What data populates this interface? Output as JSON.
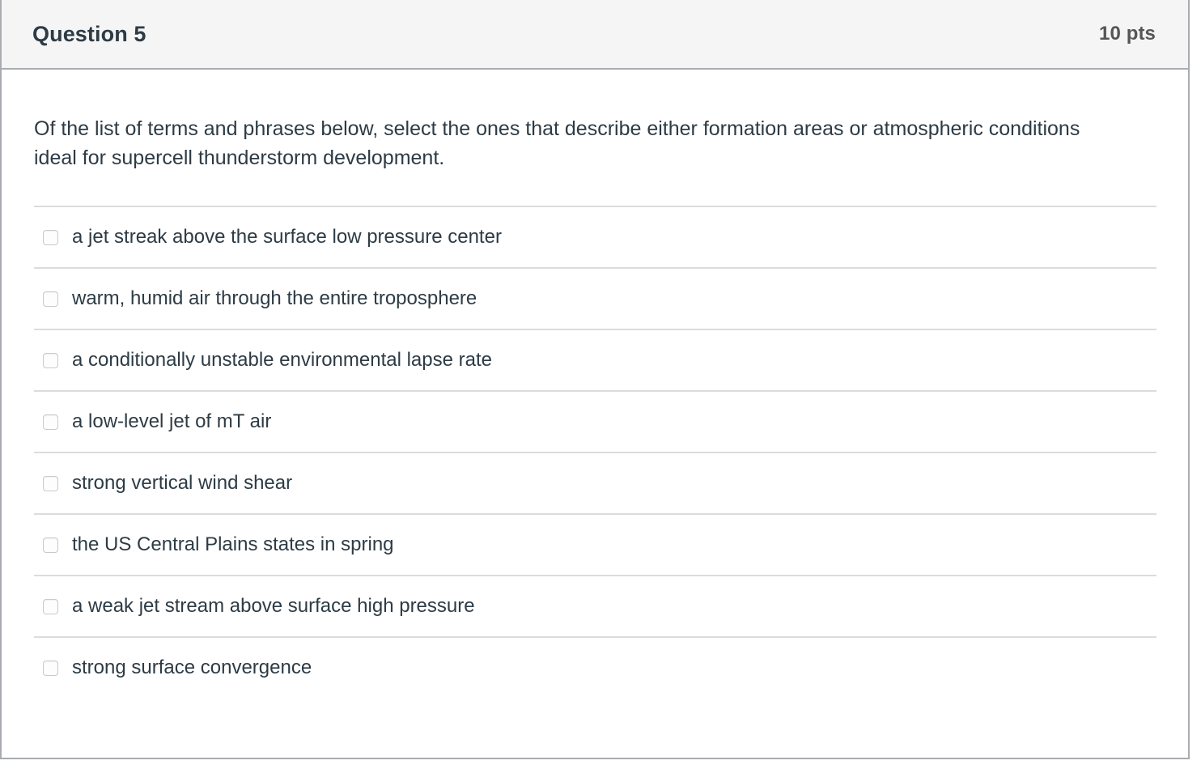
{
  "header": {
    "title": "Question 5",
    "points": "10 pts"
  },
  "question": {
    "prompt": "Of the list of terms and phrases below, select the ones that describe either formation areas or atmospheric conditions ideal for supercell thunderstorm development."
  },
  "answers": [
    {
      "label": "a jet streak above the surface low pressure center",
      "checked": false
    },
    {
      "label": "warm, humid air through the entire troposphere",
      "checked": false
    },
    {
      "label": "a conditionally unstable environmental lapse rate",
      "checked": false
    },
    {
      "label": "a low-level jet of mT air",
      "checked": false
    },
    {
      "label": "strong vertical wind shear",
      "checked": false
    },
    {
      "label": "the US Central Plains states in spring",
      "checked": false
    },
    {
      "label": "a weak jet stream above surface high pressure",
      "checked": false
    },
    {
      "label": "strong surface convergence",
      "checked": false
    }
  ],
  "colors": {
    "text": "#2d3b45",
    "points": "#555555",
    "header_bg": "#f5f5f5",
    "border": "#a9acb0",
    "divider": "#dcdcdc"
  }
}
